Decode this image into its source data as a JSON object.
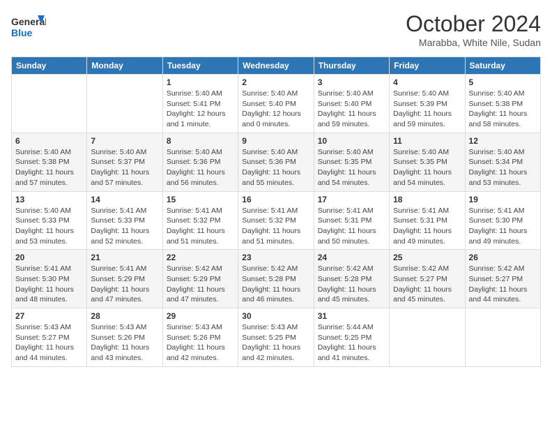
{
  "header": {
    "logo_line1": "General",
    "logo_line2": "Blue",
    "month_title": "October 2024",
    "location": "Marabba, White Nile, Sudan"
  },
  "days_of_week": [
    "Sunday",
    "Monday",
    "Tuesday",
    "Wednesday",
    "Thursday",
    "Friday",
    "Saturday"
  ],
  "weeks": [
    [
      {
        "day": "",
        "info": ""
      },
      {
        "day": "",
        "info": ""
      },
      {
        "day": "1",
        "info": "Sunrise: 5:40 AM\nSunset: 5:41 PM\nDaylight: 12 hours\nand 1 minute."
      },
      {
        "day": "2",
        "info": "Sunrise: 5:40 AM\nSunset: 5:40 PM\nDaylight: 12 hours\nand 0 minutes."
      },
      {
        "day": "3",
        "info": "Sunrise: 5:40 AM\nSunset: 5:40 PM\nDaylight: 11 hours\nand 59 minutes."
      },
      {
        "day": "4",
        "info": "Sunrise: 5:40 AM\nSunset: 5:39 PM\nDaylight: 11 hours\nand 59 minutes."
      },
      {
        "day": "5",
        "info": "Sunrise: 5:40 AM\nSunset: 5:38 PM\nDaylight: 11 hours\nand 58 minutes."
      }
    ],
    [
      {
        "day": "6",
        "info": "Sunrise: 5:40 AM\nSunset: 5:38 PM\nDaylight: 11 hours\nand 57 minutes."
      },
      {
        "day": "7",
        "info": "Sunrise: 5:40 AM\nSunset: 5:37 PM\nDaylight: 11 hours\nand 57 minutes."
      },
      {
        "day": "8",
        "info": "Sunrise: 5:40 AM\nSunset: 5:36 PM\nDaylight: 11 hours\nand 56 minutes."
      },
      {
        "day": "9",
        "info": "Sunrise: 5:40 AM\nSunset: 5:36 PM\nDaylight: 11 hours\nand 55 minutes."
      },
      {
        "day": "10",
        "info": "Sunrise: 5:40 AM\nSunset: 5:35 PM\nDaylight: 11 hours\nand 54 minutes."
      },
      {
        "day": "11",
        "info": "Sunrise: 5:40 AM\nSunset: 5:35 PM\nDaylight: 11 hours\nand 54 minutes."
      },
      {
        "day": "12",
        "info": "Sunrise: 5:40 AM\nSunset: 5:34 PM\nDaylight: 11 hours\nand 53 minutes."
      }
    ],
    [
      {
        "day": "13",
        "info": "Sunrise: 5:40 AM\nSunset: 5:33 PM\nDaylight: 11 hours\nand 53 minutes."
      },
      {
        "day": "14",
        "info": "Sunrise: 5:41 AM\nSunset: 5:33 PM\nDaylight: 11 hours\nand 52 minutes."
      },
      {
        "day": "15",
        "info": "Sunrise: 5:41 AM\nSunset: 5:32 PM\nDaylight: 11 hours\nand 51 minutes."
      },
      {
        "day": "16",
        "info": "Sunrise: 5:41 AM\nSunset: 5:32 PM\nDaylight: 11 hours\nand 51 minutes."
      },
      {
        "day": "17",
        "info": "Sunrise: 5:41 AM\nSunset: 5:31 PM\nDaylight: 11 hours\nand 50 minutes."
      },
      {
        "day": "18",
        "info": "Sunrise: 5:41 AM\nSunset: 5:31 PM\nDaylight: 11 hours\nand 49 minutes."
      },
      {
        "day": "19",
        "info": "Sunrise: 5:41 AM\nSunset: 5:30 PM\nDaylight: 11 hours\nand 49 minutes."
      }
    ],
    [
      {
        "day": "20",
        "info": "Sunrise: 5:41 AM\nSunset: 5:30 PM\nDaylight: 11 hours\nand 48 minutes."
      },
      {
        "day": "21",
        "info": "Sunrise: 5:41 AM\nSunset: 5:29 PM\nDaylight: 11 hours\nand 47 minutes."
      },
      {
        "day": "22",
        "info": "Sunrise: 5:42 AM\nSunset: 5:29 PM\nDaylight: 11 hours\nand 47 minutes."
      },
      {
        "day": "23",
        "info": "Sunrise: 5:42 AM\nSunset: 5:28 PM\nDaylight: 11 hours\nand 46 minutes."
      },
      {
        "day": "24",
        "info": "Sunrise: 5:42 AM\nSunset: 5:28 PM\nDaylight: 11 hours\nand 45 minutes."
      },
      {
        "day": "25",
        "info": "Sunrise: 5:42 AM\nSunset: 5:27 PM\nDaylight: 11 hours\nand 45 minutes."
      },
      {
        "day": "26",
        "info": "Sunrise: 5:42 AM\nSunset: 5:27 PM\nDaylight: 11 hours\nand 44 minutes."
      }
    ],
    [
      {
        "day": "27",
        "info": "Sunrise: 5:43 AM\nSunset: 5:27 PM\nDaylight: 11 hours\nand 44 minutes."
      },
      {
        "day": "28",
        "info": "Sunrise: 5:43 AM\nSunset: 5:26 PM\nDaylight: 11 hours\nand 43 minutes."
      },
      {
        "day": "29",
        "info": "Sunrise: 5:43 AM\nSunset: 5:26 PM\nDaylight: 11 hours\nand 42 minutes."
      },
      {
        "day": "30",
        "info": "Sunrise: 5:43 AM\nSunset: 5:25 PM\nDaylight: 11 hours\nand 42 minutes."
      },
      {
        "day": "31",
        "info": "Sunrise: 5:44 AM\nSunset: 5:25 PM\nDaylight: 11 hours\nand 41 minutes."
      },
      {
        "day": "",
        "info": ""
      },
      {
        "day": "",
        "info": ""
      }
    ]
  ]
}
